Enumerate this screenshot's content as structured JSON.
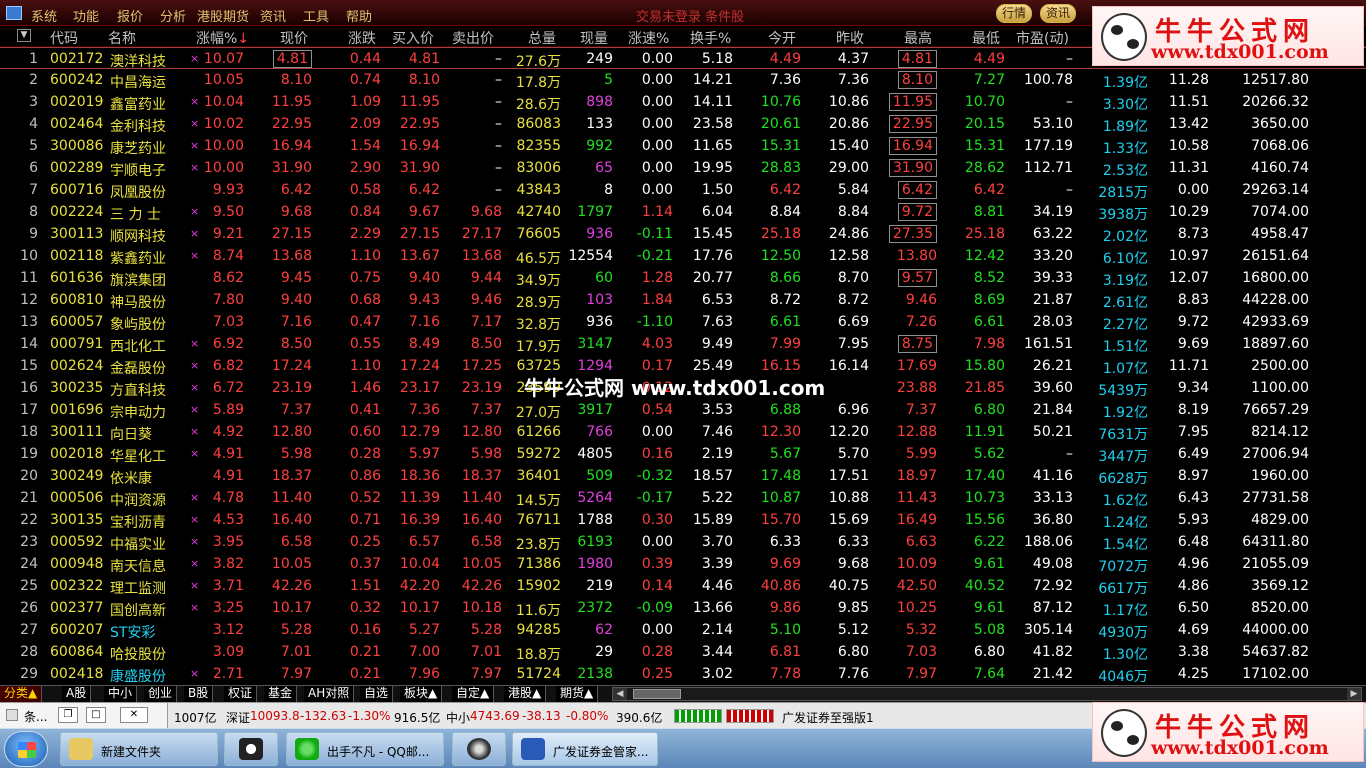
{
  "menu": [
    "系统",
    "功能",
    "报价",
    "分析",
    "港股期货",
    "资讯",
    "工具",
    "帮助"
  ],
  "window_title": "交易未登录 条件股",
  "right_buttons": [
    "行情",
    "资讯"
  ],
  "headers": [
    "代码",
    "名称",
    "涨幅%",
    "现价",
    "涨跌",
    "买入价",
    "卖出价",
    "总量",
    "现量",
    "涨速%",
    "换手%",
    "今开",
    "昨收",
    "最高",
    "最低",
    "市盈(动)",
    "",
    "",
    ""
  ],
  "sort_arrow": "↓",
  "rows": [
    {
      "n": "1",
      "code": "002172",
      "name": "澳洋科技",
      "m": "×",
      "pct": "10.07",
      "price": "4.81",
      "chg": "0.44",
      "bid": "4.81",
      "ask": "–",
      "vol": "27.6万",
      "cur": "249",
      "spd": "0.00",
      "turn": "5.18",
      "open": "4.49",
      "prev": "4.37",
      "high": "4.81",
      "low": "4.49",
      "pe": "–",
      "cap": "",
      "x1": "",
      "x2": "",
      "sel": true
    },
    {
      "n": "2",
      "code": "600242",
      "name": "中昌海运",
      "m": "",
      "pct": "10.05",
      "price": "8.10",
      "chg": "0.74",
      "bid": "8.10",
      "ask": "–",
      "vol": "17.8万",
      "cur": "5",
      "spd": "0.00",
      "turn": "14.21",
      "open": "7.36",
      "prev": "7.36",
      "high": "8.10",
      "low": "7.27",
      "pe": "100.78",
      "cap": "1.39亿",
      "x1": "11.28",
      "x2": "12517.80"
    },
    {
      "n": "3",
      "code": "002019",
      "name": "鑫富药业",
      "m": "×",
      "pct": "10.04",
      "price": "11.95",
      "chg": "1.09",
      "bid": "11.95",
      "ask": "–",
      "vol": "28.6万",
      "cur": "898",
      "spd": "0.00",
      "turn": "14.11",
      "open": "10.76",
      "prev": "10.86",
      "high": "11.95",
      "low": "10.70",
      "pe": "–",
      "cap": "3.30亿",
      "x1": "11.51",
      "x2": "20266.32"
    },
    {
      "n": "4",
      "code": "002464",
      "name": "金利科技",
      "m": "×",
      "pct": "10.02",
      "price": "22.95",
      "chg": "2.09",
      "bid": "22.95",
      "ask": "–",
      "vol": "86083",
      "cur": "133",
      "spd": "0.00",
      "turn": "23.58",
      "open": "20.61",
      "prev": "20.86",
      "high": "22.95",
      "low": "20.15",
      "pe": "53.10",
      "cap": "1.89亿",
      "x1": "13.42",
      "x2": "3650.00"
    },
    {
      "n": "5",
      "code": "300086",
      "name": "康芝药业",
      "m": "×",
      "pct": "10.00",
      "price": "16.94",
      "chg": "1.54",
      "bid": "16.94",
      "ask": "–",
      "vol": "82355",
      "cur": "992",
      "spd": "0.00",
      "turn": "11.65",
      "open": "15.31",
      "prev": "15.40",
      "high": "16.94",
      "low": "15.31",
      "pe": "177.19",
      "cap": "1.33亿",
      "x1": "10.58",
      "x2": "7068.06"
    },
    {
      "n": "6",
      "code": "002289",
      "name": "宇顺电子",
      "m": "×",
      "pct": "10.00",
      "price": "31.90",
      "chg": "2.90",
      "bid": "31.90",
      "ask": "–",
      "vol": "83006",
      "cur": "65",
      "spd": "0.00",
      "turn": "19.95",
      "open": "28.83",
      "prev": "29.00",
      "high": "31.90",
      "low": "28.62",
      "pe": "112.71",
      "cap": "2.53亿",
      "x1": "11.31",
      "x2": "4160.74"
    },
    {
      "n": "7",
      "code": "600716",
      "name": "凤凰股份",
      "m": "",
      "pct": "9.93",
      "price": "6.42",
      "chg": "0.58",
      "bid": "6.42",
      "ask": "–",
      "vol": "43843",
      "cur": "8",
      "spd": "0.00",
      "turn": "1.50",
      "open": "6.42",
      "prev": "5.84",
      "high": "6.42",
      "low": "6.42",
      "pe": "–",
      "cap": "2815万",
      "x1": "0.00",
      "x2": "29263.14"
    },
    {
      "n": "8",
      "code": "002224",
      "name": "三 力 士",
      "m": "×",
      "pct": "9.50",
      "price": "9.68",
      "chg": "0.84",
      "bid": "9.67",
      "ask": "9.68",
      "vol": "42740",
      "cur": "1797",
      "spd": "1.14",
      "turn": "6.04",
      "open": "8.84",
      "prev": "8.84",
      "high": "9.72",
      "low": "8.81",
      "pe": "34.19",
      "cap": "3938万",
      "x1": "10.29",
      "x2": "7074.00"
    },
    {
      "n": "9",
      "code": "300113",
      "name": "顺网科技",
      "m": "×",
      "pct": "9.21",
      "price": "27.15",
      "chg": "2.29",
      "bid": "27.15",
      "ask": "27.17",
      "vol": "76605",
      "cur": "936",
      "spd": "-0.11",
      "turn": "15.45",
      "open": "25.18",
      "prev": "24.86",
      "high": "27.35",
      "low": "25.18",
      "pe": "63.22",
      "cap": "2.02亿",
      "x1": "8.73",
      "x2": "4958.47"
    },
    {
      "n": "10",
      "code": "002118",
      "name": "紫鑫药业",
      "m": "×",
      "pct": "8.74",
      "price": "13.68",
      "chg": "1.10",
      "bid": "13.67",
      "ask": "13.68",
      "vol": "46.5万",
      "cur": "12554",
      "spd": "-0.21",
      "turn": "17.76",
      "open": "12.50",
      "prev": "12.58",
      "high": "13.80",
      "low": "12.42",
      "pe": "33.20",
      "cap": "6.10亿",
      "x1": "10.97",
      "x2": "26151.64"
    },
    {
      "n": "11",
      "code": "601636",
      "name": "旗滨集团",
      "m": "",
      "pct": "8.62",
      "price": "9.45",
      "chg": "0.75",
      "bid": "9.40",
      "ask": "9.44",
      "vol": "34.9万",
      "cur": "60",
      "spd": "1.28",
      "turn": "20.77",
      "open": "8.66",
      "prev": "8.70",
      "high": "9.57",
      "low": "8.52",
      "pe": "39.33",
      "cap": "3.19亿",
      "x1": "12.07",
      "x2": "16800.00"
    },
    {
      "n": "12",
      "code": "600810",
      "name": "神马股份",
      "m": "",
      "pct": "7.80",
      "price": "9.40",
      "chg": "0.68",
      "bid": "9.43",
      "ask": "9.46",
      "vol": "28.9万",
      "cur": "103",
      "spd": "1.84",
      "turn": "6.53",
      "open": "8.72",
      "prev": "8.72",
      "high": "9.46",
      "low": "8.69",
      "pe": "21.87",
      "cap": "2.61亿",
      "x1": "8.83",
      "x2": "44228.00"
    },
    {
      "n": "13",
      "code": "600057",
      "name": "象屿股份",
      "m": "",
      "pct": "7.03",
      "price": "7.16",
      "chg": "0.47",
      "bid": "7.16",
      "ask": "7.17",
      "vol": "32.8万",
      "cur": "936",
      "spd": "-1.10",
      "turn": "7.63",
      "open": "6.61",
      "prev": "6.69",
      "high": "7.26",
      "low": "6.61",
      "pe": "28.03",
      "cap": "2.27亿",
      "x1": "9.72",
      "x2": "42933.69"
    },
    {
      "n": "14",
      "code": "000791",
      "name": "西北化工",
      "m": "×",
      "pct": "6.92",
      "price": "8.50",
      "chg": "0.55",
      "bid": "8.49",
      "ask": "8.50",
      "vol": "17.9万",
      "cur": "3147",
      "spd": "4.03",
      "turn": "9.49",
      "open": "7.99",
      "prev": "7.95",
      "high": "8.75",
      "low": "7.98",
      "pe": "161.51",
      "cap": "1.51亿",
      "x1": "9.69",
      "x2": "18897.60"
    },
    {
      "n": "15",
      "code": "002624",
      "name": "金磊股份",
      "m": "×",
      "pct": "6.82",
      "price": "17.24",
      "chg": "1.10",
      "bid": "17.24",
      "ask": "17.25",
      "vol": "63725",
      "cur": "1294",
      "spd": "0.17",
      "turn": "25.49",
      "open": "16.15",
      "prev": "16.14",
      "high": "17.69",
      "low": "15.80",
      "pe": "26.21",
      "cap": "1.07亿",
      "x1": "11.71",
      "x2": "2500.00"
    },
    {
      "n": "16",
      "code": "300235",
      "name": "方直科技",
      "m": "×",
      "pct": "6.72",
      "price": "23.19",
      "chg": "1.46",
      "bid": "23.17",
      "ask": "23.19",
      "vol": "23599",
      "cur": "",
      "spd": "0.12",
      "turn": "",
      "open": "",
      "prev": "",
      "high": "23.88",
      "low": "21.85",
      "pe": "39.60",
      "cap": "5439万",
      "x1": "9.34",
      "x2": "1100.00"
    },
    {
      "n": "17",
      "code": "001696",
      "name": "宗申动力",
      "m": "×",
      "pct": "5.89",
      "price": "7.37",
      "chg": "0.41",
      "bid": "7.36",
      "ask": "7.37",
      "vol": "27.0万",
      "cur": "3917",
      "spd": "0.54",
      "turn": "3.53",
      "open": "6.88",
      "prev": "6.96",
      "high": "7.37",
      "low": "6.80",
      "pe": "21.84",
      "cap": "1.92亿",
      "x1": "8.19",
      "x2": "76657.29"
    },
    {
      "n": "18",
      "code": "300111",
      "name": "向日葵",
      "m": "×",
      "pct": "4.92",
      "price": "12.80",
      "chg": "0.60",
      "bid": "12.79",
      "ask": "12.80",
      "vol": "61266",
      "cur": "766",
      "spd": "0.00",
      "turn": "7.46",
      "open": "12.30",
      "prev": "12.20",
      "high": "12.88",
      "low": "11.91",
      "pe": "50.21",
      "cap": "7631万",
      "x1": "7.95",
      "x2": "8214.12"
    },
    {
      "n": "19",
      "code": "002018",
      "name": "华星化工",
      "m": "×",
      "pct": "4.91",
      "price": "5.98",
      "chg": "0.28",
      "bid": "5.97",
      "ask": "5.98",
      "vol": "59272",
      "cur": "4805",
      "spd": "0.16",
      "turn": "2.19",
      "open": "5.67",
      "prev": "5.70",
      "high": "5.99",
      "low": "5.62",
      "pe": "–",
      "cap": "3447万",
      "x1": "6.49",
      "x2": "27006.94"
    },
    {
      "n": "20",
      "code": "300249",
      "name": "依米康",
      "m": "",
      "pct": "4.91",
      "price": "18.37",
      "chg": "0.86",
      "bid": "18.36",
      "ask": "18.37",
      "vol": "36401",
      "cur": "509",
      "spd": "-0.32",
      "turn": "18.57",
      "open": "17.48",
      "prev": "17.51",
      "high": "18.97",
      "low": "17.40",
      "pe": "41.16",
      "cap": "6628万",
      "x1": "8.97",
      "x2": "1960.00"
    },
    {
      "n": "21",
      "code": "000506",
      "name": "中润资源",
      "m": "×",
      "pct": "4.78",
      "price": "11.40",
      "chg": "0.52",
      "bid": "11.39",
      "ask": "11.40",
      "vol": "14.5万",
      "cur": "5264",
      "spd": "-0.17",
      "turn": "5.22",
      "open": "10.87",
      "prev": "10.88",
      "high": "11.43",
      "low": "10.73",
      "pe": "33.13",
      "cap": "1.62亿",
      "x1": "6.43",
      "x2": "27731.58"
    },
    {
      "n": "22",
      "code": "300135",
      "name": "宝利沥青",
      "m": "×",
      "pct": "4.53",
      "price": "16.40",
      "chg": "0.71",
      "bid": "16.39",
      "ask": "16.40",
      "vol": "76711",
      "cur": "1788",
      "spd": "0.30",
      "turn": "15.89",
      "open": "15.70",
      "prev": "15.69",
      "high": "16.49",
      "low": "15.56",
      "pe": "36.80",
      "cap": "1.24亿",
      "x1": "5.93",
      "x2": "4829.00"
    },
    {
      "n": "23",
      "code": "000592",
      "name": "中福实业",
      "m": "×",
      "pct": "3.95",
      "price": "6.58",
      "chg": "0.25",
      "bid": "6.57",
      "ask": "6.58",
      "vol": "23.8万",
      "cur": "6193",
      "spd": "0.00",
      "turn": "3.70",
      "open": "6.33",
      "prev": "6.33",
      "high": "6.63",
      "low": "6.22",
      "pe": "188.06",
      "cap": "1.54亿",
      "x1": "6.48",
      "x2": "64311.80"
    },
    {
      "n": "24",
      "code": "000948",
      "name": "南天信息",
      "m": "×",
      "pct": "3.82",
      "price": "10.05",
      "chg": "0.37",
      "bid": "10.04",
      "ask": "10.05",
      "vol": "71386",
      "cur": "1980",
      "spd": "0.39",
      "turn": "3.39",
      "open": "9.69",
      "prev": "9.68",
      "high": "10.09",
      "low": "9.61",
      "pe": "49.08",
      "cap": "7072万",
      "x1": "4.96",
      "x2": "21055.09"
    },
    {
      "n": "25",
      "code": "002322",
      "name": "理工监测",
      "m": "×",
      "pct": "3.71",
      "price": "42.26",
      "chg": "1.51",
      "bid": "42.20",
      "ask": "42.26",
      "vol": "15902",
      "cur": "219",
      "spd": "0.14",
      "turn": "4.46",
      "open": "40.86",
      "prev": "40.75",
      "high": "42.50",
      "low": "40.52",
      "pe": "72.92",
      "cap": "6617万",
      "x1": "4.86",
      "x2": "3569.12"
    },
    {
      "n": "26",
      "code": "002377",
      "name": "国创高新",
      "m": "×",
      "pct": "3.25",
      "price": "10.17",
      "chg": "0.32",
      "bid": "10.17",
      "ask": "10.18",
      "vol": "11.6万",
      "cur": "2372",
      "spd": "-0.09",
      "turn": "13.66",
      "open": "9.86",
      "prev": "9.85",
      "high": "10.25",
      "low": "9.61",
      "pe": "87.12",
      "cap": "1.17亿",
      "x1": "6.50",
      "x2": "8520.00"
    },
    {
      "n": "27",
      "code": "600207",
      "name": "ST安彩",
      "m": "",
      "pct": "3.12",
      "price": "5.28",
      "chg": "0.16",
      "bid": "5.27",
      "ask": "5.28",
      "vol": "94285",
      "cur": "62",
      "spd": "0.00",
      "turn": "2.14",
      "open": "5.10",
      "prev": "5.12",
      "high": "5.32",
      "low": "5.08",
      "pe": "305.14",
      "cap": "4930万",
      "x1": "4.69",
      "x2": "44000.00"
    },
    {
      "n": "28",
      "code": "600864",
      "name": "哈投股份",
      "m": "",
      "pct": "3.09",
      "price": "7.01",
      "chg": "0.21",
      "bid": "7.00",
      "ask": "7.01",
      "vol": "18.8万",
      "cur": "29",
      "spd": "0.28",
      "turn": "3.44",
      "open": "6.81",
      "prev": "6.80",
      "high": "7.03",
      "low": "6.80",
      "pe": "41.82",
      "cap": "1.30亿",
      "x1": "3.38",
      "x2": "54637.82"
    },
    {
      "n": "29",
      "code": "002418",
      "name": "康盛股份",
      "m": "×",
      "pct": "2.71",
      "price": "7.97",
      "chg": "0.21",
      "bid": "7.96",
      "ask": "7.97",
      "vol": "51724",
      "cur": "2138",
      "spd": "0.25",
      "turn": "3.02",
      "open": "7.78",
      "prev": "7.76",
      "high": "7.97",
      "low": "7.64",
      "pe": "21.42",
      "cap": "4046万",
      "x1": "4.25",
      "x2": "17102.00"
    }
  ],
  "tabs": [
    "分类▲",
    "A股",
    "中小",
    "创业",
    "B股",
    "权证",
    "基金",
    "AH对照",
    "自选",
    "板块▲",
    "自定▲",
    "港股▲",
    "期货▲"
  ],
  "status": {
    "mini_label": "条...",
    "sz_value": "1007亿",
    "sz_label": "深证",
    "sz_index": "10093.8",
    "sz_chg": "-132.63",
    "sz_pct": "-1.30%",
    "sz_amt": "916.5亿",
    "zx_label": "中小",
    "zx_index": "4743.69",
    "zx_chg": "-38.13",
    "zx_pct": "-0.80%",
    "zx_amt": "390.6亿",
    "broker": "广发证券至强版1"
  },
  "taskbar": [
    "新建文件夹",
    "出手不凡 - QQ邮...",
    "广发证券金管家..."
  ],
  "watermark": {
    "name": "牛牛公式网",
    "url": "www.tdx001.com",
    "center": "牛牛公式网 www.tdx001.com"
  }
}
